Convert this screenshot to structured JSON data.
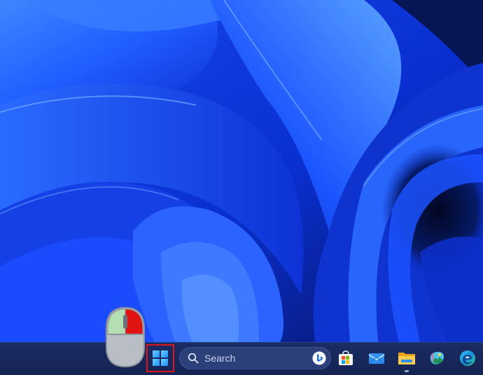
{
  "desktop": {
    "wallpaper": "windows-11-bloom",
    "colors": {
      "accent_blue": "#1e56ff",
      "deep_blue": "#0a1f8f",
      "dark_navy": "#050d36",
      "taskbar": "#1a2c63"
    }
  },
  "taskbar": {
    "start_button": {
      "icon": "windows-logo-icon",
      "highlighted": true,
      "highlight_color": "#e0141b"
    },
    "search": {
      "placeholder": "Search",
      "icon": "search-icon",
      "bing_icon": "bing-icon"
    },
    "pinned_apps": [
      {
        "icon": "microsoft-store-icon"
      },
      {
        "icon": "mail-icon"
      },
      {
        "icon": "file-explorer-icon",
        "running": true
      },
      {
        "icon": "photos-icon"
      },
      {
        "icon": "edge-icon"
      }
    ]
  },
  "mouse_indicator": {
    "icon": "mouse-left-click-icon",
    "pressed_button": "right",
    "pressed_color": "#e11313"
  }
}
